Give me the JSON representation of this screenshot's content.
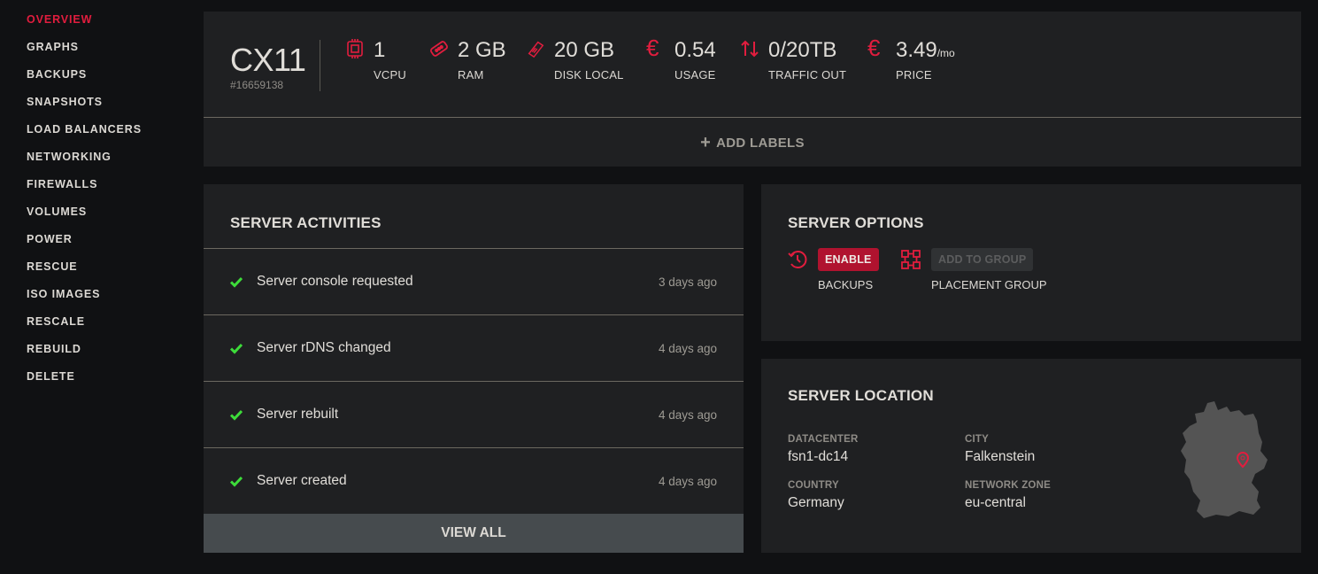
{
  "sidebar": {
    "items": [
      {
        "label": "OVERVIEW",
        "active": true
      },
      {
        "label": "GRAPHS"
      },
      {
        "label": "BACKUPS"
      },
      {
        "label": "SNAPSHOTS"
      },
      {
        "label": "LOAD BALANCERS"
      },
      {
        "label": "NETWORKING"
      },
      {
        "label": "FIREWALLS"
      },
      {
        "label": "VOLUMES"
      },
      {
        "label": "POWER"
      },
      {
        "label": "RESCUE"
      },
      {
        "label": "ISO IMAGES"
      },
      {
        "label": "RESCALE"
      },
      {
        "label": "REBUILD"
      },
      {
        "label": "DELETE"
      }
    ]
  },
  "header": {
    "server_name": "CX11",
    "server_id": "#16659138",
    "specs": [
      {
        "icon": "cpu-icon",
        "value": "1",
        "label": "VCPU"
      },
      {
        "icon": "ram-icon",
        "value": "2 GB",
        "label": "RAM"
      },
      {
        "icon": "disk-icon",
        "value": "20 GB",
        "label": "DISK LOCAL"
      },
      {
        "icon": "euro-icon",
        "value": "0.54",
        "label": "USAGE"
      },
      {
        "icon": "traffic-arrows-icon",
        "value": "0/20TB",
        "label": "TRAFFIC OUT"
      },
      {
        "icon": "euro-icon",
        "value": "3.49",
        "suffix": "/mo",
        "label": "PRICE"
      }
    ],
    "add_labels": "ADD LABELS",
    "add_labels_icon": "+"
  },
  "activities": {
    "title": "SERVER ACTIVITIES",
    "items": [
      {
        "text": "Server console requested",
        "time": "3 days ago",
        "status": "success"
      },
      {
        "text": "Server rDNS changed",
        "time": "4 days ago",
        "status": "success"
      },
      {
        "text": "Server rebuilt",
        "time": "4 days ago",
        "status": "success"
      },
      {
        "text": "Server created",
        "time": "4 days ago",
        "status": "success"
      }
    ],
    "view_all": "VIEW ALL"
  },
  "options": {
    "title": "SERVER OPTIONS",
    "backups": {
      "button": "ENABLE",
      "label": "BACKUPS"
    },
    "placement_group": {
      "button": "ADD TO GROUP",
      "label": "PLACEMENT GROUP",
      "disabled": true
    }
  },
  "location": {
    "title": "SERVER LOCATION",
    "fields": [
      {
        "key": "DATACENTER",
        "value": "fsn1-dc14"
      },
      {
        "key": "CITY",
        "value": "Falkenstein"
      },
      {
        "key": "COUNTRY",
        "value": "Germany"
      },
      {
        "key": "NETWORK ZONE",
        "value": "eu-central"
      }
    ]
  },
  "colors": {
    "accent": "#e11d3e",
    "enable_button": "#b0132f",
    "success": "#3ddc3a",
    "card_bg": "#1f2022",
    "page_bg": "#101113",
    "view_all_bg": "#464b4e",
    "map_fill": "#545454"
  }
}
